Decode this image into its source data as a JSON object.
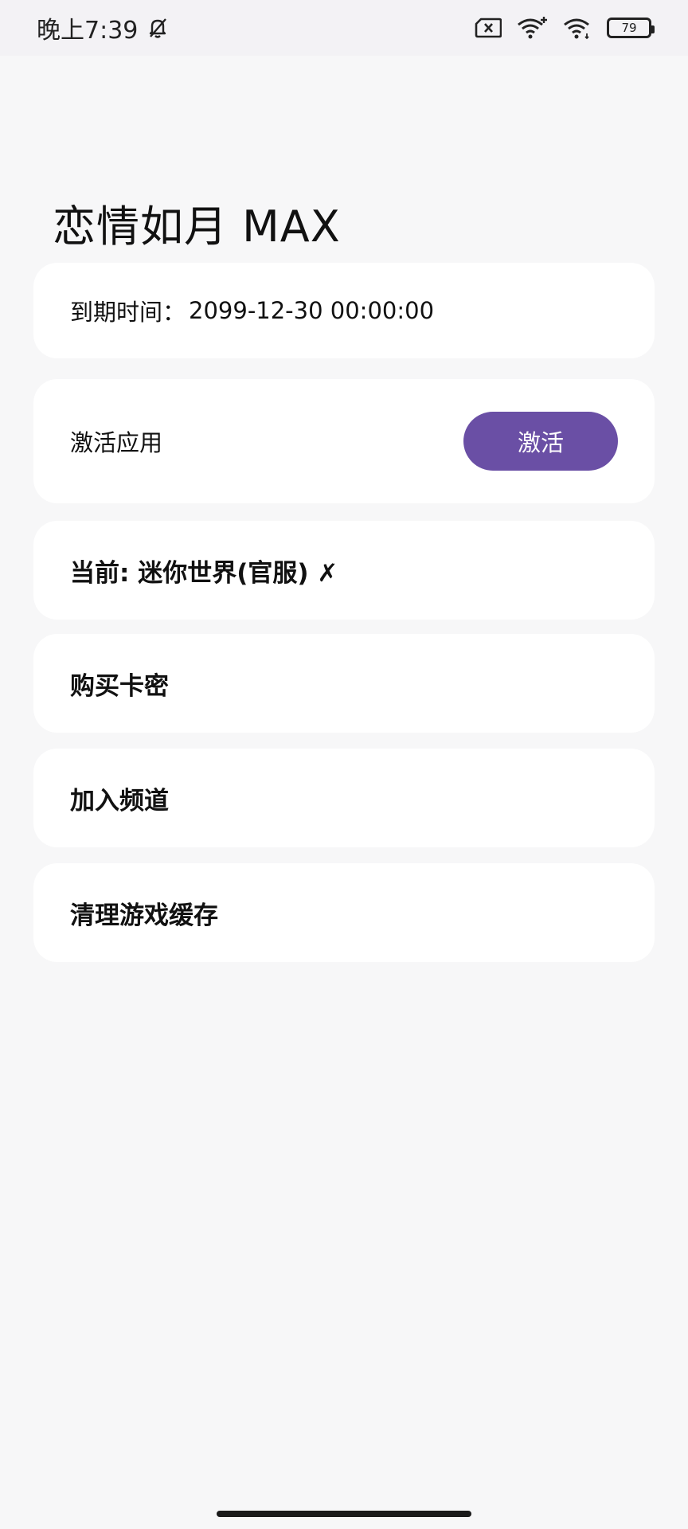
{
  "status_bar": {
    "time": "晚上7:39",
    "battery": "79"
  },
  "app": {
    "title": "恋情如月 MAX"
  },
  "expiry": {
    "label": "到期时间：",
    "value": "2099-12-30 00:00:00"
  },
  "activate": {
    "label": "激活应用",
    "button": "激活"
  },
  "current": {
    "label": "当前: 迷你世界(官服) ✗"
  },
  "menu": {
    "buy": "购买卡密",
    "channel": "加入频道",
    "clear_cache": "清理游戏缓存"
  },
  "colors": {
    "accent": "#6a4fa5",
    "background": "#f7f7f8",
    "card": "#ffffff"
  }
}
